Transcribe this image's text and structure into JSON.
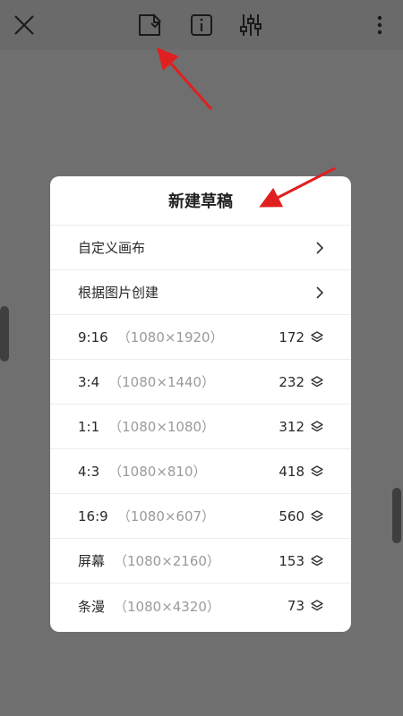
{
  "dialog": {
    "title": "新建草稿",
    "nav_items": [
      {
        "label": "自定义画布"
      },
      {
        "label": "根据图片创建"
      }
    ],
    "presets": [
      {
        "ratio": "9:16",
        "dims": "（1080×1920）",
        "count": "172"
      },
      {
        "ratio": "3:4",
        "dims": "（1080×1440）",
        "count": "232"
      },
      {
        "ratio": "1:1",
        "dims": "（1080×1080）",
        "count": "312"
      },
      {
        "ratio": "4:3",
        "dims": "（1080×810）",
        "count": "418"
      },
      {
        "ratio": "16:9",
        "dims": "（1080×607）",
        "count": "560"
      },
      {
        "ratio": "屏幕",
        "dims": "（1080×2160）",
        "count": "153"
      },
      {
        "ratio": "条漫",
        "dims": "（1080×4320）",
        "count": "73"
      }
    ]
  },
  "toolbar": {
    "icons": [
      "close-icon",
      "new-draft-icon",
      "info-icon",
      "adjust-sliders-icon",
      "more-vertical-icon"
    ]
  },
  "colors": {
    "overlay": "#6f6f6f",
    "annotation_arrow": "#e02020",
    "dialog_bg": "#ffffff"
  }
}
